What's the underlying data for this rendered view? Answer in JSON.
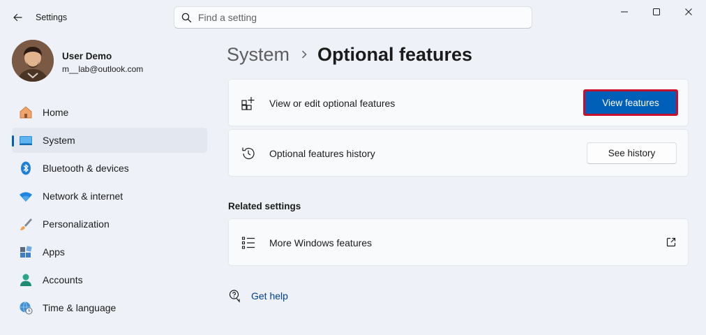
{
  "window": {
    "title": "Settings",
    "search_placeholder": "Find a setting"
  },
  "user": {
    "name": "User Demo",
    "email": "m__lab@outlook.com"
  },
  "sidebar": {
    "items": [
      {
        "label": "Home",
        "icon": "home-icon"
      },
      {
        "label": "System",
        "icon": "system-icon",
        "selected": true
      },
      {
        "label": "Bluetooth & devices",
        "icon": "bluetooth-icon"
      },
      {
        "label": "Network & internet",
        "icon": "wifi-icon"
      },
      {
        "label": "Personalization",
        "icon": "brush-icon"
      },
      {
        "label": "Apps",
        "icon": "apps-icon"
      },
      {
        "label": "Accounts",
        "icon": "person-icon"
      },
      {
        "label": "Time & language",
        "icon": "globe-clock-icon"
      }
    ]
  },
  "breadcrumb": {
    "parent": "System",
    "current": "Optional features"
  },
  "cards": {
    "view_edit": {
      "label": "View or edit optional features",
      "button": "View features",
      "icon": "add-grid-icon"
    },
    "history": {
      "label": "Optional features history",
      "button": "See history",
      "icon": "history-icon"
    }
  },
  "related": {
    "title": "Related settings",
    "windows_features": {
      "label": "More Windows features",
      "icon": "list-icon",
      "action_icon": "open-external-icon"
    }
  },
  "help": {
    "label": "Get help"
  },
  "colors": {
    "accent": "#005fb8",
    "highlight_border": "#c8102e",
    "background": "#eef2f8",
    "card": "#f9fafc"
  }
}
